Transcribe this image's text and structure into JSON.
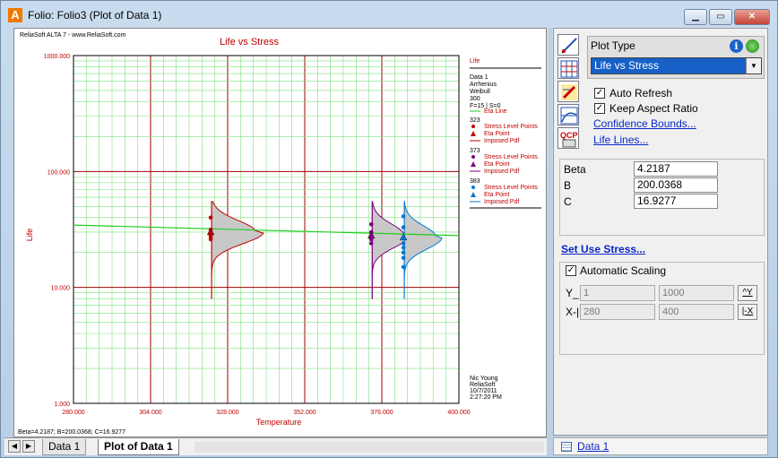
{
  "window": {
    "title": "Folio: Folio3 (Plot of Data 1)",
    "app_icon": "A",
    "min_glyph": "▁",
    "max_glyph": "▭",
    "close_glyph": "✕"
  },
  "plot": {
    "header": "ReliaSoft ALTA 7 - www.ReliaSoft.com",
    "footer": "Beta=4.2187; B=200.0368; C=16.9277",
    "legend": {
      "title": "Life",
      "info": [
        "Data 1",
        "Arrhenius",
        "Weibull",
        "300",
        "F=15 | S=0"
      ],
      "eta_line": "Eta Line",
      "groups": [
        {
          "stress": "323",
          "color": "#c00000"
        },
        {
          "stress": "373",
          "color": "#800080"
        },
        {
          "stress": "383",
          "color": "#0078d0"
        }
      ],
      "stress_points": "Stress Level Points",
      "eta_point": "Eta Point",
      "imposed_pdf": "Imposed Pdf"
    },
    "signature": [
      "Nic Young",
      "ReliaSoft",
      "10/7/2011",
      "2:27:20 PM"
    ]
  },
  "chart_data": {
    "type": "scatter",
    "title": "Life vs Stress",
    "xlabel": "Temperature",
    "ylabel": "Life",
    "xlim": [
      280,
      400
    ],
    "ylim": [
      1,
      1000
    ],
    "y_scale": "log",
    "x_ticks": [
      "280.000",
      "304.000",
      "328.000",
      "352.000",
      "376.000",
      "400.000"
    ],
    "y_ticks": [
      "1000.000",
      "100.000",
      "10.000",
      "1.000"
    ],
    "eta_line": {
      "x": [
        280,
        400
      ],
      "y": [
        34.5,
        28.0
      ]
    },
    "groups": [
      {
        "stress": 323,
        "color": "#c00000",
        "points": [
          40,
          31.5,
          30,
          29,
          28,
          27,
          26
        ],
        "eta": 30
      },
      {
        "stress": 373,
        "color": "#800080",
        "points": [
          35,
          30,
          28,
          27,
          26,
          24
        ],
        "eta": 28
      },
      {
        "stress": 383,
        "color": "#0078d0",
        "points": [
          41,
          33,
          27,
          24,
          22,
          20,
          18,
          15
        ],
        "eta": 27
      }
    ]
  },
  "panel": {
    "plot_type_label": "Plot Type",
    "plot_type_value": "Life vs Stress",
    "info_glyph": "i",
    "auto_refresh": "Auto Refresh",
    "keep_aspect": "Keep Aspect Ratio",
    "confidence_bounds": "Confidence Bounds...",
    "life_lines": "Life Lines...",
    "params": [
      {
        "name": "Beta",
        "value": "4.2187"
      },
      {
        "name": "B",
        "value": "200.0368"
      },
      {
        "name": "C",
        "value": "16.9277"
      }
    ],
    "set_use_stress": "Set Use Stress...",
    "automatic_scaling": "Automatic Scaling",
    "y_axis_label": "Y_",
    "x_axis_label": "X-|",
    "y_min": "1",
    "y_max": "1000",
    "x_min": "280",
    "x_max": "400",
    "y_btn": "^Y",
    "x_btn": "|-X",
    "check_glyph": "✓",
    "status_link": "Data 1"
  },
  "tabs": {
    "data1": "Data 1",
    "plot": "Plot of Data 1",
    "nav_prev": "◀",
    "nav_next": "▶"
  }
}
